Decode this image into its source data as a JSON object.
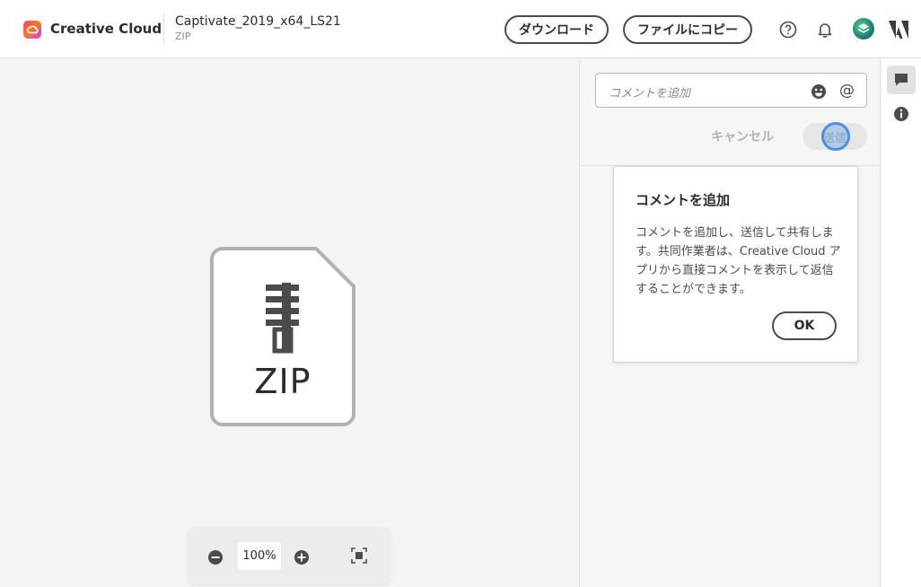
{
  "header": {
    "brand": "Creative Cloud",
    "file_name": "Captivate_2019_x64_LS21",
    "file_type": "ZIP",
    "download_label": "ダウンロード",
    "copy_label": "ファイルにコピー",
    "icons": [
      "creative-cloud-logo",
      "help-icon",
      "bell-icon",
      "avatar",
      "adobe-icon"
    ]
  },
  "preview": {
    "file_badge": "ZIP",
    "zoom_value": "100%",
    "icons": [
      "zoom-out-icon",
      "zoom-in-icon",
      "fit-screen-icon"
    ]
  },
  "comments": {
    "input_placeholder": "コメントを追加",
    "cancel_label": "キャンセル",
    "send_label": "送信",
    "icons": [
      "emoji-icon",
      "at-icon"
    ]
  },
  "popover": {
    "title": "コメントを追加",
    "body": "コメントを追加し、送信して共有します。共同作業者は、Creative Cloud アプリから直接コメントを表示して返信することができます。",
    "ok_label": "OK"
  },
  "rail": {
    "icons": [
      "comments-icon",
      "info-icon"
    ]
  },
  "colors": {
    "focus_ring": "#4a90e2",
    "text_primary": "#2c2c2c",
    "disabled_text": "#b3b3b3"
  }
}
